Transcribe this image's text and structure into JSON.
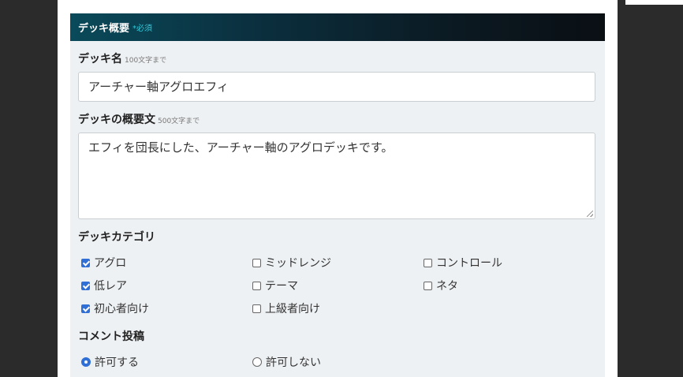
{
  "section": {
    "title": "デッキ概要",
    "required": "*必須"
  },
  "deck_name": {
    "label": "デッキ名",
    "hint": "100文字まで",
    "value": "アーチャー軸アグロエフィ"
  },
  "deck_desc": {
    "label": "デッキの概要文",
    "hint": "500文字まで",
    "value": "エフィを団長にした、アーチャー軸のアグロデッキです。"
  },
  "category": {
    "label": "デッキカテゴリ",
    "options": [
      {
        "label": "アグロ",
        "checked": true
      },
      {
        "label": "ミッドレンジ",
        "checked": false
      },
      {
        "label": "コントロール",
        "checked": false
      },
      {
        "label": "低レア",
        "checked": true
      },
      {
        "label": "テーマ",
        "checked": false
      },
      {
        "label": "ネタ",
        "checked": false
      },
      {
        "label": "初心者向け",
        "checked": true
      },
      {
        "label": "上級者向け",
        "checked": false
      }
    ]
  },
  "comments": {
    "label": "コメント投稿",
    "options": [
      {
        "label": "許可する",
        "selected": true
      },
      {
        "label": "許可しない",
        "selected": false
      }
    ]
  },
  "colors": {
    "accent": "#2f6fd6",
    "required": "#2fc8d8",
    "header_start": "#0a4a5a",
    "header_end": "#0a0f14"
  }
}
